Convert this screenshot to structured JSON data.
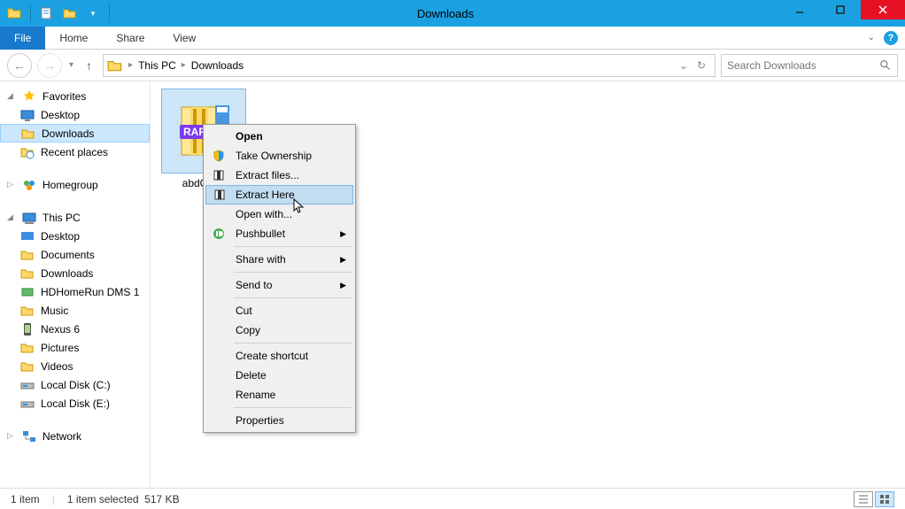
{
  "window": {
    "title": "Downloads"
  },
  "ribbon": {
    "file": "File",
    "tabs": [
      "Home",
      "Share",
      "View"
    ]
  },
  "breadcrumb": {
    "items": [
      "This PC",
      "Downloads"
    ]
  },
  "search": {
    "placeholder": "Search Downloads"
  },
  "nav": {
    "favorites": {
      "label": "Favorites",
      "items": [
        "Desktop",
        "Downloads",
        "Recent places"
      ]
    },
    "homegroup": {
      "label": "Homegroup"
    },
    "thispc": {
      "label": "This PC",
      "items": [
        "Desktop",
        "Documents",
        "Downloads",
        "HDHomeRun DMS 1",
        "Music",
        "Nexus 6",
        "Pictures",
        "Videos",
        "Local Disk (C:)",
        "Local Disk (E:)"
      ]
    },
    "network": {
      "label": "Network"
    }
  },
  "file": {
    "name": "abdGui..."
  },
  "context_menu": {
    "items": [
      {
        "label": "Open",
        "bold": true
      },
      {
        "label": "Take Ownership",
        "icon": "shield"
      },
      {
        "label": "Extract files...",
        "icon": "archive"
      },
      {
        "label": "Extract Here",
        "icon": "archive",
        "hover": true
      },
      {
        "label": "Open with..."
      },
      {
        "label": "Pushbullet",
        "icon": "pushbullet",
        "submenu": true
      },
      {
        "sep": true
      },
      {
        "label": "Share with",
        "submenu": true
      },
      {
        "sep": true
      },
      {
        "label": "Send to",
        "submenu": true
      },
      {
        "sep": true
      },
      {
        "label": "Cut"
      },
      {
        "label": "Copy"
      },
      {
        "sep": true
      },
      {
        "label": "Create shortcut"
      },
      {
        "label": "Delete"
      },
      {
        "label": "Rename"
      },
      {
        "sep": true
      },
      {
        "label": "Properties"
      }
    ]
  },
  "status": {
    "count": "1 item",
    "selected": "1 item selected",
    "size": "517 KB"
  }
}
